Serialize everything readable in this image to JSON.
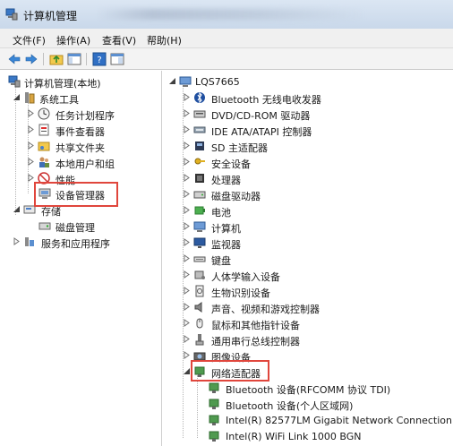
{
  "window": {
    "title": "计算机管理"
  },
  "menu": {
    "file": "文件(F)",
    "action": "操作(A)",
    "view": "查看(V)",
    "help": "帮助(H)"
  },
  "toolbar": {
    "icons": [
      "back-arrow-icon",
      "forward-arrow-icon",
      "up-folder-icon",
      "show-hide-tree-icon",
      "help-icon",
      "properties-icon"
    ]
  },
  "left_tree": {
    "root": "计算机管理(本地)",
    "system_tools": "系统工具",
    "task_scheduler": "任务计划程序",
    "event_viewer": "事件查看器",
    "shared_folders": "共享文件夹",
    "local_users": "本地用户和组",
    "performance": "性能",
    "device_manager": "设备管理器",
    "storage": "存储",
    "disk_management": "磁盘管理",
    "services_apps": "服务和应用程序"
  },
  "device_tree": {
    "computer": "LQS7665",
    "categories": [
      "Bluetooth 无线电收发器",
      "DVD/CD-ROM 驱动器",
      "IDE ATA/ATAPI 控制器",
      "SD 主适配器",
      "安全设备",
      "处理器",
      "磁盘驱动器",
      "电池",
      "计算机",
      "监视器",
      "键盘",
      "人体学输入设备",
      "生物识别设备",
      "声音、视频和游戏控制器",
      "鼠标和其他指针设备",
      "通用串行总线控制器",
      "图像设备"
    ],
    "network": {
      "label": "网络适配器",
      "children": [
        "Bluetooth 设备(RFCOMM 协议 TDI)",
        "Bluetooth 设备(个人区域网)",
        "Intel(R) 82577LM Gigabit Network Connection",
        "Intel(R) WiFi Link 1000 BGN"
      ]
    }
  },
  "colors": {
    "highlight": "#e0463c",
    "titlebar": "#c9d8ea"
  }
}
